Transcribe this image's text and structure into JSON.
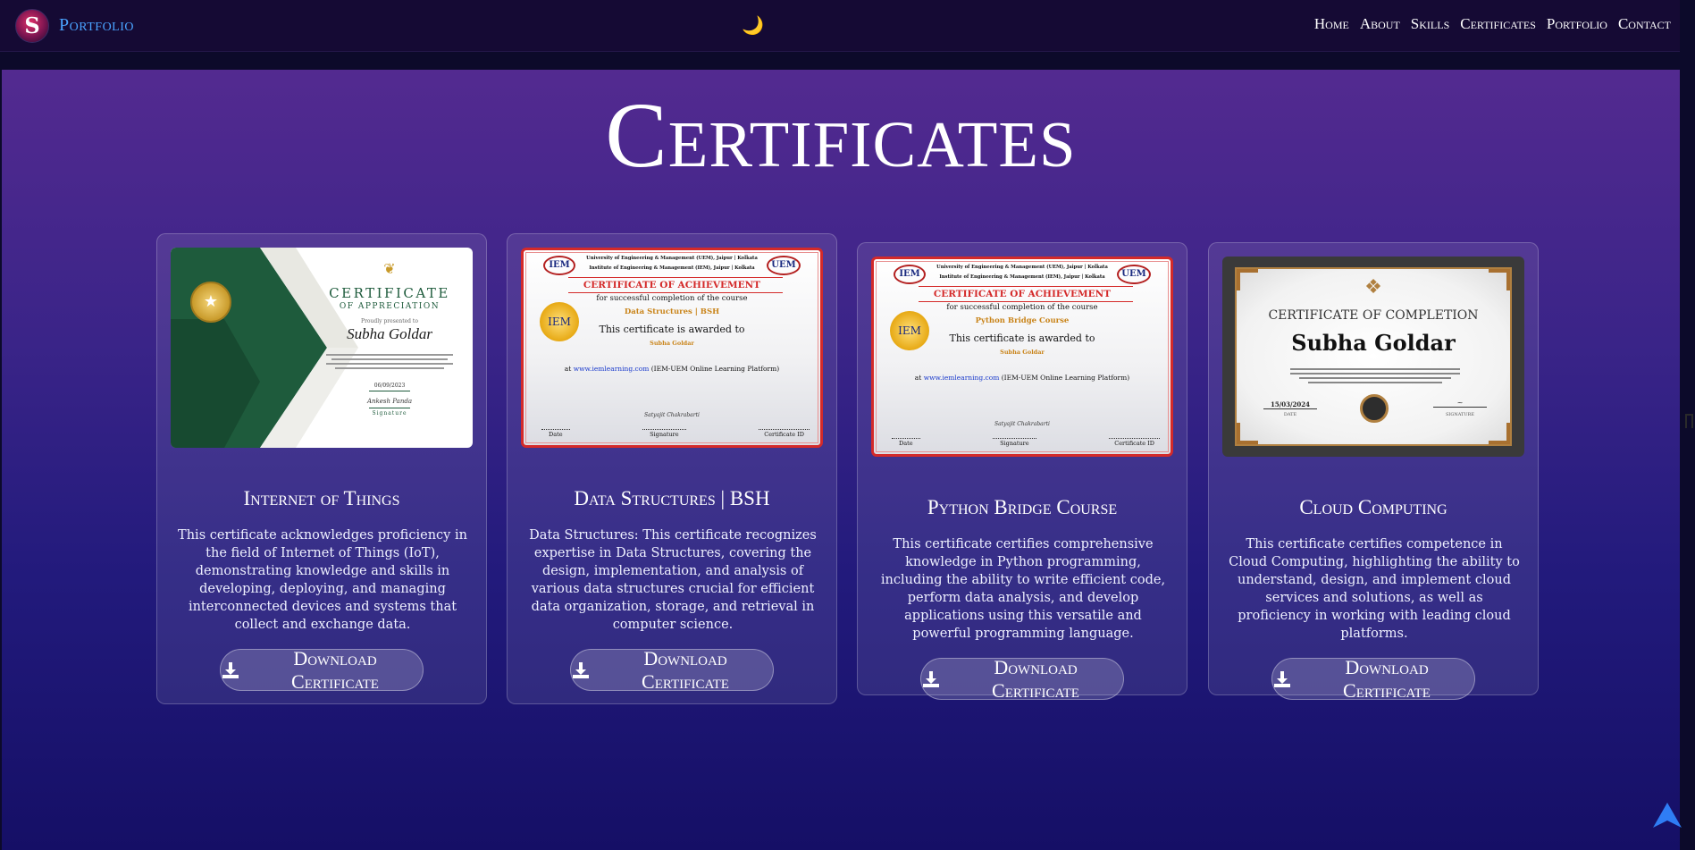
{
  "nav": {
    "logo_letter": "S",
    "brand": "Portfolio",
    "theme_icon": "🌙",
    "links": [
      "Home",
      "About",
      "Skills",
      "Certificates",
      "Portfolio",
      "Contact"
    ]
  },
  "section": {
    "title": "Certificates"
  },
  "certificates": [
    {
      "title": "Internet of Things",
      "description": "This certificate acknowledges proficiency in the field of Internet of Things (IoT), demonstrating knowledge and skills in developing, deploying, and managing interconnected devices and systems that collect and exchange data.",
      "button": "Download Certificate",
      "image": {
        "heading": "CERTIFICATE",
        "subheading": "OF APPRECIATION",
        "presented": "Proudly presented to",
        "name": "Subha Goldar",
        "date": "06/09/2023",
        "signer": "Ankesh Panda",
        "signature_label": "Signature"
      }
    },
    {
      "title": "Data Structures | BSH",
      "description": "Data Structures: This certificate recognizes expertise in Data Structures, covering the design, implementation, and analysis of various data structures crucial for efficient data organization, storage, and retrieval in computer science.",
      "button": "Download Certificate",
      "image": {
        "logo_left": "IEM",
        "logo_right": "UEM",
        "university_line": "University of Engineering & Management (UEM), Jaipur | Kolkata",
        "institute_line": "Institute of Engineering & Management (IEM), Jaipur | Kolkata",
        "heading": "CERTIFICATE OF ACHIEVEMENT",
        "completion": "for successful completion of the course",
        "course": "Data Structures | BSH",
        "awarded": "This certificate is awarded to",
        "name": "Subha Goldar",
        "platform_prefix": "at",
        "platform_link": "www.iemlearning.com",
        "platform_suffix": "(IEM-UEM Online Learning Platform)",
        "signer": "Satyajit Chakrabarti",
        "footer": [
          "Date",
          "Signature",
          "Certificate ID"
        ]
      }
    },
    {
      "title": "Python Bridge Course",
      "description": "This certificate certifies comprehensive knowledge in Python programming, including the ability to write efficient code, perform data analysis, and develop applications using this versatile and powerful programming language.",
      "button": "Download Certificate",
      "image": {
        "logo_left": "IEM",
        "logo_right": "UEM",
        "university_line": "University of Engineering & Management (UEM), Jaipur | Kolkata",
        "institute_line": "Institute of Engineering & Management (IEM), Jaipur | Kolkata",
        "heading": "CERTIFICATE OF ACHIEVEMENT",
        "completion": "for successful completion of the course",
        "course": "Python Bridge Course",
        "awarded": "This certificate is awarded to",
        "name": "Subha Goldar",
        "platform_prefix": "at",
        "platform_link": "www.iemlearning.com",
        "platform_suffix": "(IEM-UEM Online Learning Platform)",
        "signer": "Satyajit Chakrabarti",
        "footer": [
          "Date",
          "Signature",
          "Certificate ID"
        ]
      }
    },
    {
      "title": "Cloud Computing",
      "description": "This certificate certifies competence in Cloud Computing, highlighting the ability to understand, design, and implement cloud services and solutions, as well as proficiency in working with leading cloud platforms.",
      "button": "Download Certificate",
      "image": {
        "heading": "CERTIFICATE OF COMPLETION",
        "name": "Subha Goldar",
        "date": "15/03/2024",
        "date_label": "DATE",
        "signature_label": "SIGNATURE"
      }
    }
  ],
  "colors": {
    "nav_bg": "#150a34",
    "brand": "#4aa3ff",
    "gradient_top": "#532a90",
    "gradient_bottom": "#150f66",
    "cert_red": "#d42a2a",
    "cert_green": "#1e5b3c"
  },
  "icons": {
    "download": "download-icon",
    "scroll_top": "arrow-up-icon",
    "bookmark": "bookmark-icon"
  }
}
